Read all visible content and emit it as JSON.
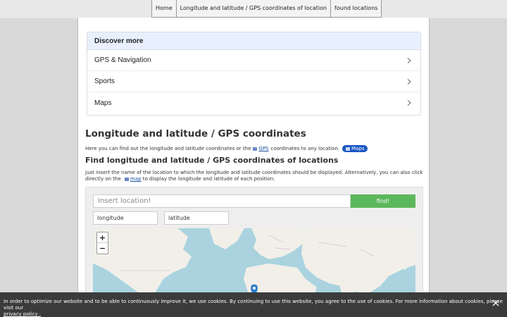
{
  "nav": {
    "items": [
      "Home",
      "Longitude and latitude / GPS coordinates of location",
      "found locations"
    ]
  },
  "discover": {
    "heading": "Discover more",
    "items": [
      "GPS & Navigation",
      "Sports",
      "Maps"
    ]
  },
  "page": {
    "title": "Longitude and latitude / GPS coordinates",
    "intro_before": "Here you can find out the longitude and latitude coordinates or the",
    "intro_link": "GPS",
    "intro_after": "coordinates to any location.",
    "maps_pill": "Maps",
    "subtitle": "Find longitude and latitude / GPS coordinates of locations",
    "desc_before": "Just insert the name of the location to which the longitude and latitude coordinates should be displayed. Alternatively, you can also click directly on the",
    "desc_link": "map",
    "desc_after": "to display the longitude and latitude of each position."
  },
  "tool": {
    "location_placeholder": "Insert location!",
    "find_label": "find!",
    "longitude_placeholder": "longitude",
    "latitude_placeholder": "latitude",
    "zoom_in": "+",
    "zoom_out": "−"
  },
  "cookie": {
    "text": "In order to optimize our website and to be able to continuously improve it, we use cookies. By continuing to use this website, you agree to the use of cookies. For more information about cookies, please visit our",
    "link": "privacy policy ."
  },
  "colors": {
    "accent": "#5cb85c",
    "pill": "#1a56c4",
    "map_water": "#aad3df",
    "map_land": "#f2efe9"
  }
}
